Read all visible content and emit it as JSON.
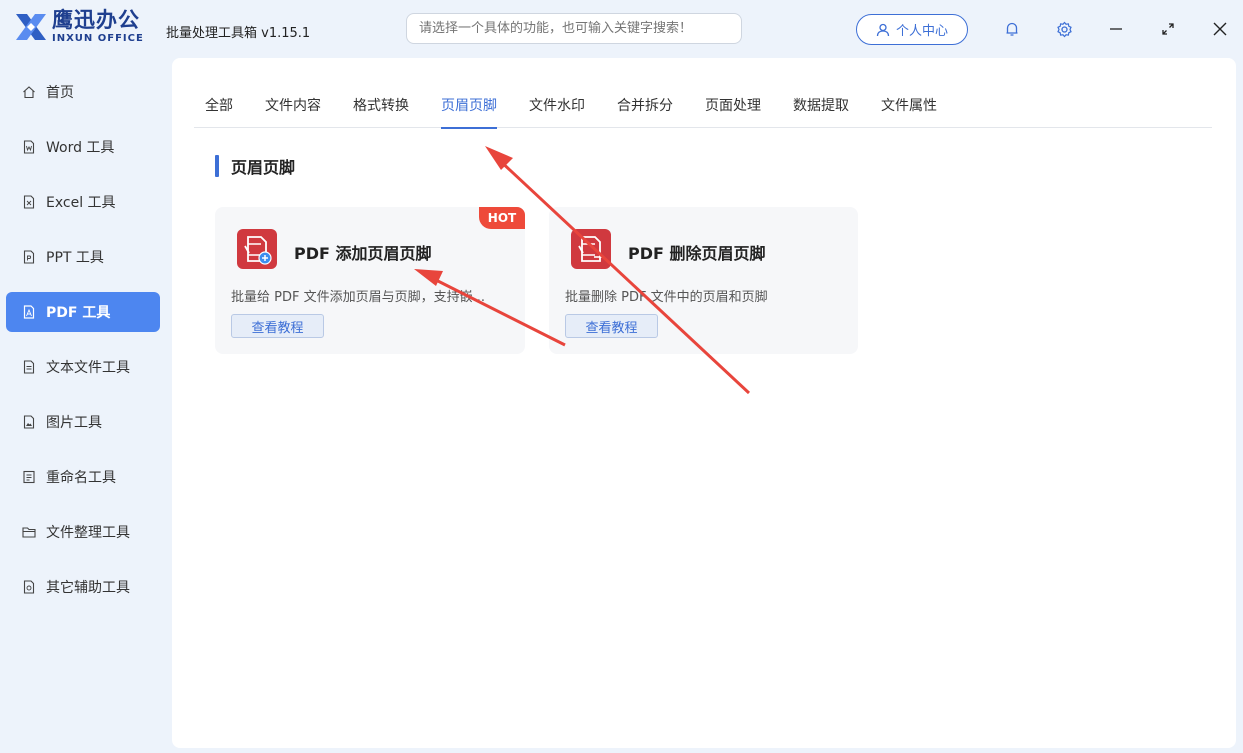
{
  "app": {
    "logo_cn": "鹰迅办公",
    "logo_en": "INXUN OFFICE",
    "title": "批量处理工具箱 v1.15.1"
  },
  "search": {
    "placeholder": "请选择一个具体的功能，也可输入关键字搜索！"
  },
  "header": {
    "user_center": "个人中心"
  },
  "sidebar": {
    "items": [
      {
        "label": "首页",
        "icon": "home-icon"
      },
      {
        "label": "Word 工具",
        "icon": "word-file-icon"
      },
      {
        "label": "Excel 工具",
        "icon": "excel-file-icon"
      },
      {
        "label": "PPT 工具",
        "icon": "ppt-file-icon"
      },
      {
        "label": "PDF 工具",
        "icon": "pdf-file-icon",
        "active": true
      },
      {
        "label": "文本文件工具",
        "icon": "text-file-icon"
      },
      {
        "label": "图片工具",
        "icon": "image-file-icon"
      },
      {
        "label": "重命名工具",
        "icon": "rename-icon"
      },
      {
        "label": "文件整理工具",
        "icon": "folder-icon"
      },
      {
        "label": "其它辅助工具",
        "icon": "tools-icon"
      }
    ]
  },
  "tabs": [
    {
      "label": "全部"
    },
    {
      "label": "文件内容"
    },
    {
      "label": "格式转换"
    },
    {
      "label": "页眉页脚",
      "active": true
    },
    {
      "label": "文件水印"
    },
    {
      "label": "合并拆分"
    },
    {
      "label": "页面处理"
    },
    {
      "label": "数据提取"
    },
    {
      "label": "文件属性"
    }
  ],
  "section": {
    "title": "页眉页脚"
  },
  "cards": [
    {
      "title": "PDF 添加页眉页脚",
      "description": "批量给 PDF 文件添加页眉与页脚，支持嵌...",
      "button": "查看教程",
      "badge": "HOT",
      "icon": "pdf-add-icon"
    },
    {
      "title": "PDF 删除页眉页脚",
      "description": "批量删除 PDF 文件中的页眉和页脚",
      "button": "查看教程",
      "icon": "pdf-remove-icon"
    }
  ],
  "colors": {
    "accent": "#3d6fd6",
    "sidebar_active": "#4d86f0",
    "pdf_icon": "#d0393f",
    "hot_badge": "#ee4a3a",
    "annotation_arrow": "#e8453c"
  }
}
